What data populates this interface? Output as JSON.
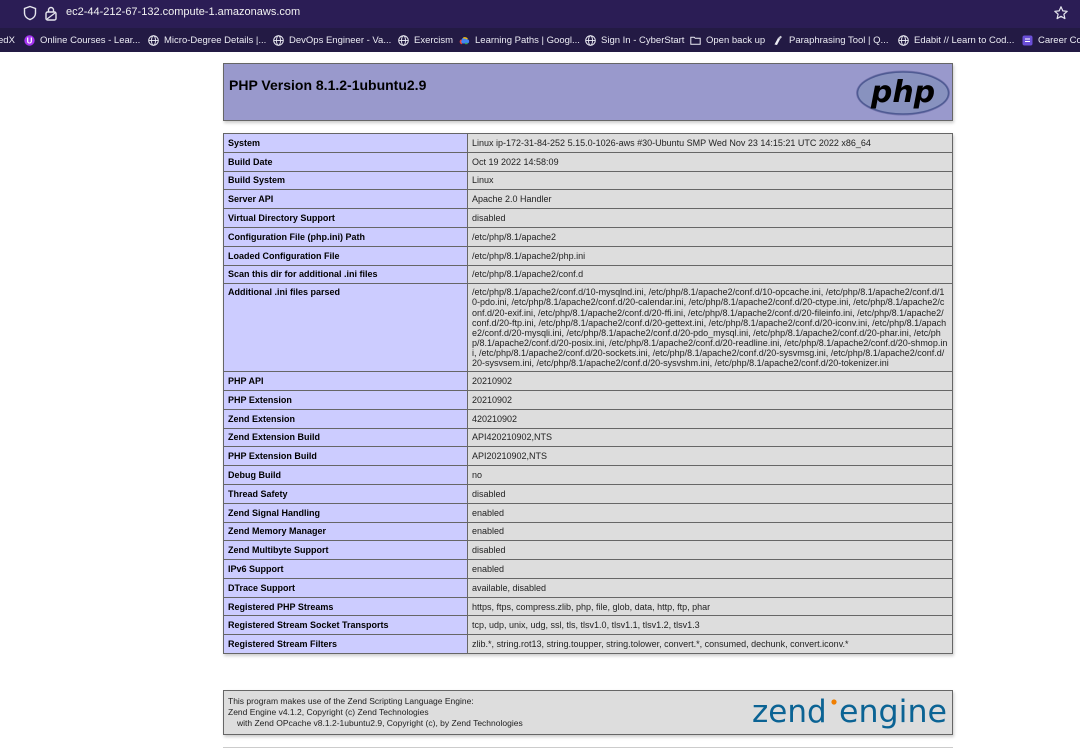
{
  "browser": {
    "url": "ec2-44-212-67-132.compute-1.amazonaws.com",
    "bookmarks": [
      {
        "label": "edX",
        "icon": "edx-icon"
      },
      {
        "label": "Online Courses - Lear...",
        "icon": "udemy-icon"
      },
      {
        "label": "Micro-Degree Details |...",
        "icon": "globe-icon"
      },
      {
        "label": "DevOps Engineer - Va...",
        "icon": "globe-icon"
      },
      {
        "label": "Exercism",
        "icon": "globe-icon"
      },
      {
        "label": "Learning Paths | Googl...",
        "icon": "google-cloud-icon"
      },
      {
        "label": "Sign In - CyberStart",
        "icon": "globe-icon"
      },
      {
        "label": "Open back up",
        "icon": "folder-icon"
      },
      {
        "label": "Paraphrasing Tool | Q...",
        "icon": "quillbot-icon"
      },
      {
        "label": "Edabit // Learn to Cod...",
        "icon": "globe-icon"
      },
      {
        "label": "Career Co",
        "icon": "career-icon"
      }
    ]
  },
  "phpinfo": {
    "title": "PHP Version 8.1.2-1ubuntu2.9",
    "logo_text": "php",
    "rows": [
      {
        "key": "System",
        "value": "Linux ip-172-31-84-252 5.15.0-1026-aws #30-Ubuntu SMP Wed Nov 23 14:15:21 UTC 2022 x86_64"
      },
      {
        "key": "Build Date",
        "value": "Oct 19 2022 14:58:09"
      },
      {
        "key": "Build System",
        "value": "Linux"
      },
      {
        "key": "Server API",
        "value": "Apache 2.0 Handler"
      },
      {
        "key": "Virtual Directory Support",
        "value": "disabled"
      },
      {
        "key": "Configuration File (php.ini) Path",
        "value": "/etc/php/8.1/apache2"
      },
      {
        "key": "Loaded Configuration File",
        "value": "/etc/php/8.1/apache2/php.ini"
      },
      {
        "key": "Scan this dir for additional .ini files",
        "value": "/etc/php/8.1/apache2/conf.d"
      },
      {
        "key": "Additional .ini files parsed",
        "value": "/etc/php/8.1/apache2/conf.d/10-mysqlnd.ini, /etc/php/8.1/apache2/conf.d/10-opcache.ini, /etc/php/8.1/apache2/conf.d/10-pdo.ini, /etc/php/8.1/apache2/conf.d/20-calendar.ini, /etc/php/8.1/apache2/conf.d/20-ctype.ini, /etc/php/8.1/apache2/conf.d/20-exif.ini, /etc/php/8.1/apache2/conf.d/20-ffi.ini, /etc/php/8.1/apache2/conf.d/20-fileinfo.ini, /etc/php/8.1/apache2/conf.d/20-ftp.ini, /etc/php/8.1/apache2/conf.d/20-gettext.ini, /etc/php/8.1/apache2/conf.d/20-iconv.ini, /etc/php/8.1/apache2/conf.d/20-mysqli.ini, /etc/php/8.1/apache2/conf.d/20-pdo_mysql.ini, /etc/php/8.1/apache2/conf.d/20-phar.ini, /etc/php/8.1/apache2/conf.d/20-posix.ini, /etc/php/8.1/apache2/conf.d/20-readline.ini, /etc/php/8.1/apache2/conf.d/20-shmop.ini, /etc/php/8.1/apache2/conf.d/20-sockets.ini, /etc/php/8.1/apache2/conf.d/20-sysvmsg.ini, /etc/php/8.1/apache2/conf.d/20-sysvsem.ini, /etc/php/8.1/apache2/conf.d/20-sysvshm.ini, /etc/php/8.1/apache2/conf.d/20-tokenizer.ini"
      },
      {
        "key": "PHP API",
        "value": "20210902"
      },
      {
        "key": "PHP Extension",
        "value": "20210902"
      },
      {
        "key": "Zend Extension",
        "value": "420210902"
      },
      {
        "key": "Zend Extension Build",
        "value": "API420210902,NTS"
      },
      {
        "key": "PHP Extension Build",
        "value": "API20210902,NTS"
      },
      {
        "key": "Debug Build",
        "value": "no"
      },
      {
        "key": "Thread Safety",
        "value": "disabled"
      },
      {
        "key": "Zend Signal Handling",
        "value": "enabled"
      },
      {
        "key": "Zend Memory Manager",
        "value": "enabled"
      },
      {
        "key": "Zend Multibyte Support",
        "value": "disabled"
      },
      {
        "key": "IPv6 Support",
        "value": "enabled"
      },
      {
        "key": "DTrace Support",
        "value": "available, disabled"
      },
      {
        "key": "Registered PHP Streams",
        "value": "https, ftps, compress.zlib, php, file, glob, data, http, ftp, phar"
      },
      {
        "key": "Registered Stream Socket Transports",
        "value": "tcp, udp, unix, udg, ssl, tls, tlsv1.0, tlsv1.1, tlsv1.2, tlsv1.3"
      },
      {
        "key": "Registered Stream Filters",
        "value": "zlib.*, string.rot13, string.toupper, string.tolower, convert.*, consumed, dechunk, convert.iconv.*"
      }
    ],
    "zend": {
      "line1": "This program makes use of the Zend Scripting Language Engine:",
      "line2": "Zend Engine v4.1.2, Copyright (c) Zend Technologies",
      "line3": "with Zend OPcache v8.1.2-1ubuntu2.9, Copyright (c), by Zend Technologies",
      "logo_word1": "zend",
      "logo_word2": "engine"
    }
  },
  "colors": {
    "header_bg": "#9999cc",
    "key_bg": "#ccccff",
    "value_bg": "#dddddd",
    "browser_bar": "#2b1d55",
    "zend_blue": "#0b6394",
    "zend_orange": "#f07e00"
  }
}
